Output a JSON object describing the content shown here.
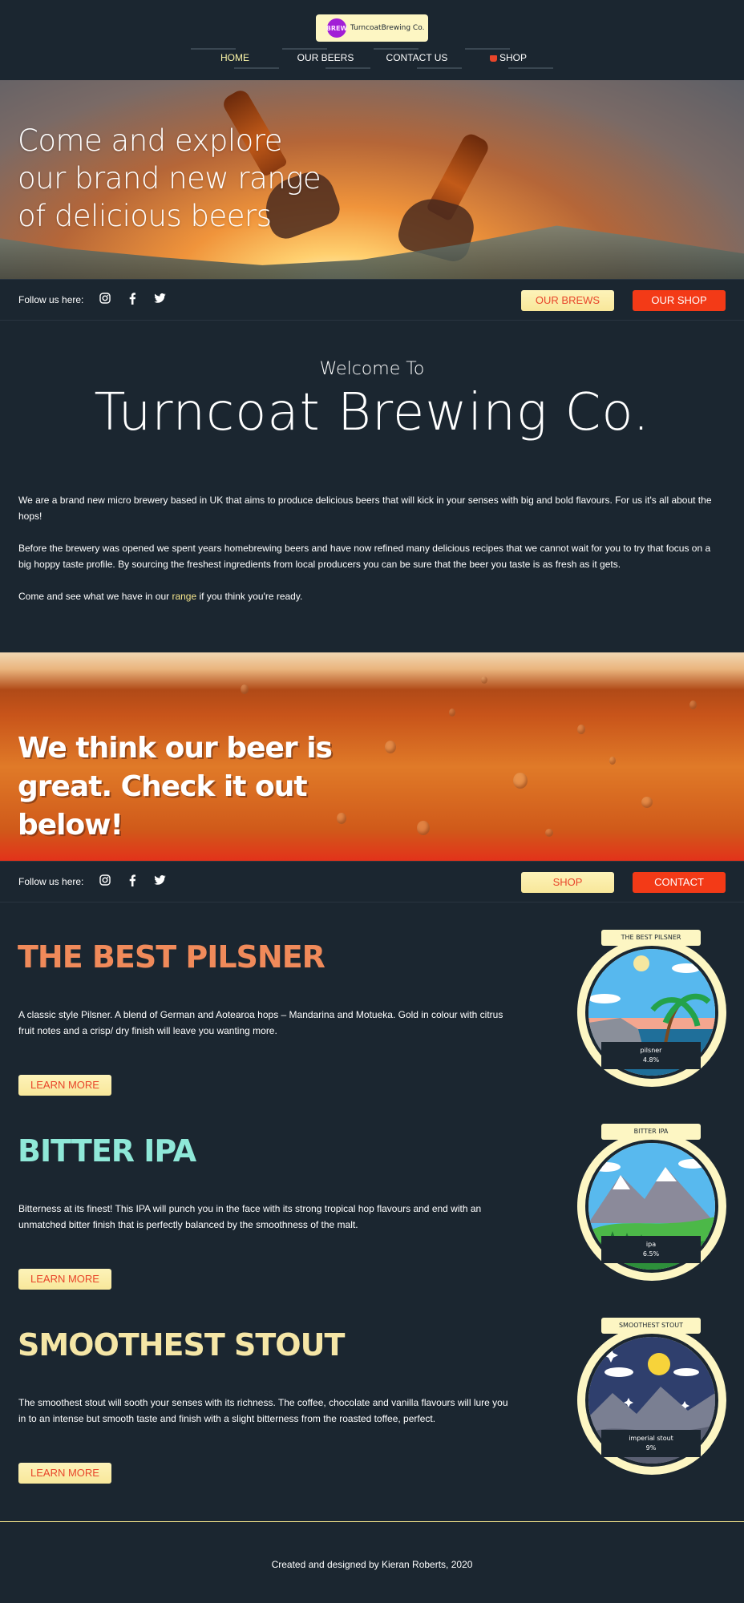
{
  "brand": {
    "logo_mark": "BREW",
    "logo_text": "TurncoatBrewing Co."
  },
  "nav": [
    {
      "label": "HOME",
      "active": true
    },
    {
      "label": "OUR BEERS"
    },
    {
      "label": "CONTACT US"
    },
    {
      "label": "SHOP"
    }
  ],
  "hero": {
    "title": "Come and explore our brand new range of delicious beers"
  },
  "social_bar_1": {
    "follow": "Follow us here:",
    "btn_left": "OUR BREWS",
    "btn_right": "OUR SHOP"
  },
  "welcome": {
    "small": "Welcome To",
    "big": "Turncoat Brewing Co.",
    "p1": "We are a brand new micro brewery based in UK that aims to produce delicious beers that will kick in your senses with big and bold flavours. For us it's all about the hops!",
    "p2": "Before the brewery was opened we spent years homebrewing beers and have now refined many delicious recipes that we cannot wait for you to try that focus on a big hoppy taste profile. By sourcing the freshest ingredients from local producers you can be sure that the beer you taste is as fresh as it gets.",
    "p3_before": "Come and see what we have in our ",
    "p3_link": "range",
    "p3_after": " if you think you're ready."
  },
  "band": {
    "title": "We think our beer is great. Check it out below!"
  },
  "social_bar_2": {
    "follow": "Follow us here:",
    "btn_left": "SHOP",
    "btn_right": "CONTACT"
  },
  "beers": [
    {
      "title": "THE BEST PILSNER",
      "desc": "A classic style Pilsner. A blend of German and Aotearoa hops – Mandarina and Motueka. Gold in colour with citrus fruit notes and a crisp/ dry finish will leave you wanting more.",
      "button": "LEARN MORE",
      "badge_top": "THE BEST PILSNER",
      "badge_name": "pilsner",
      "badge_abv": "4.8%",
      "title_color": "#f08a5a"
    },
    {
      "title": "BITTER IPA",
      "desc": "Bitterness at its finest! This IPA will punch you in the face with its strong tropical hop flavours and end with an unmatched bitter finish that is perfectly balanced by the smoothness of the malt.",
      "button": "LEARN MORE",
      "badge_top": "BITTER IPA",
      "badge_name": "ipa",
      "badge_abv": "6.5%",
      "title_color": "#8fe8d8"
    },
    {
      "title": "SMOOTHEST STOUT",
      "desc": "The smoothest stout will sooth your senses with its richness. The coffee, chocolate and vanilla flavours will lure you in to an intense but smooth taste and finish with a slight bitterness from the roasted toffee, perfect.",
      "button": "LEARN MORE",
      "badge_top": "SMOOTHEST STOUT",
      "badge_name": "imperial stout",
      "badge_abv": "9%",
      "title_color": "#f5e6a6"
    }
  ],
  "footer": {
    "text": "Created and designed by Kieran Roberts, 2020"
  },
  "icons": [
    "instagram-icon",
    "facebook-icon",
    "twitter-icon",
    "cart-icon"
  ]
}
